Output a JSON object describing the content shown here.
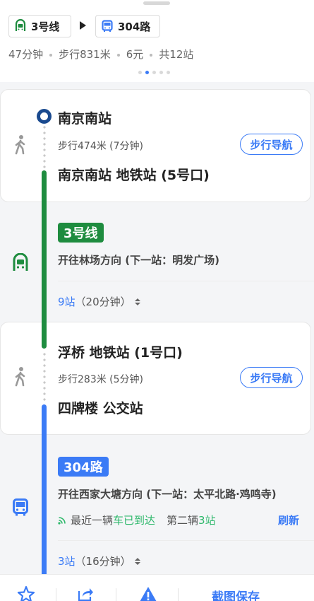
{
  "header": {
    "route": [
      {
        "label": "3号线",
        "icon": "metro-icon",
        "color": "#1e8c3f"
      },
      {
        "label": "304路",
        "icon": "bus-icon",
        "color": "#3b7bf6"
      }
    ],
    "summary": {
      "duration": "47分钟",
      "walk": "步行831米",
      "price": "6元",
      "stops": "共12站"
    }
  },
  "steps": {
    "start_station": "南京南站",
    "walk1": {
      "text": "步行474米 (7分钟)",
      "nav_label": "步行导航",
      "to": "南京南站 地铁站 (5号口)"
    },
    "metro": {
      "line": "3号线",
      "color": "#1e8c3f",
      "direction": "开往林场方向 (下一站：明发广场)",
      "stops_count": "9站",
      "stops_time": "（20分钟）"
    },
    "transfer_exit": "浮桥 地铁站 (1号口)",
    "walk2": {
      "text": "步行283米 (5分钟)",
      "nav_label": "步行导航",
      "to": "四牌楼 公交站"
    },
    "bus": {
      "line": "304路",
      "color": "#3b7bf6",
      "direction": "开往西家大塘方向 (下一站：太平北路·鸡鸣寺)",
      "realtime_prefix": "最近一辆",
      "realtime_status": "车已到达",
      "second_prefix": "第二辆",
      "second_value": "3站",
      "refresh_label": "刷新",
      "stops_count": "3站",
      "stops_time": "（16分钟）"
    }
  },
  "bottom_bar": {
    "save_label": "截图保存",
    "icons": [
      "star-icon",
      "share-icon",
      "warning-icon"
    ]
  },
  "colors": {
    "accent": "#3b7bf6",
    "metro_green": "#1e8c3f",
    "realtime_green": "#2eb86b",
    "start_ring": "#1a4a8f"
  }
}
